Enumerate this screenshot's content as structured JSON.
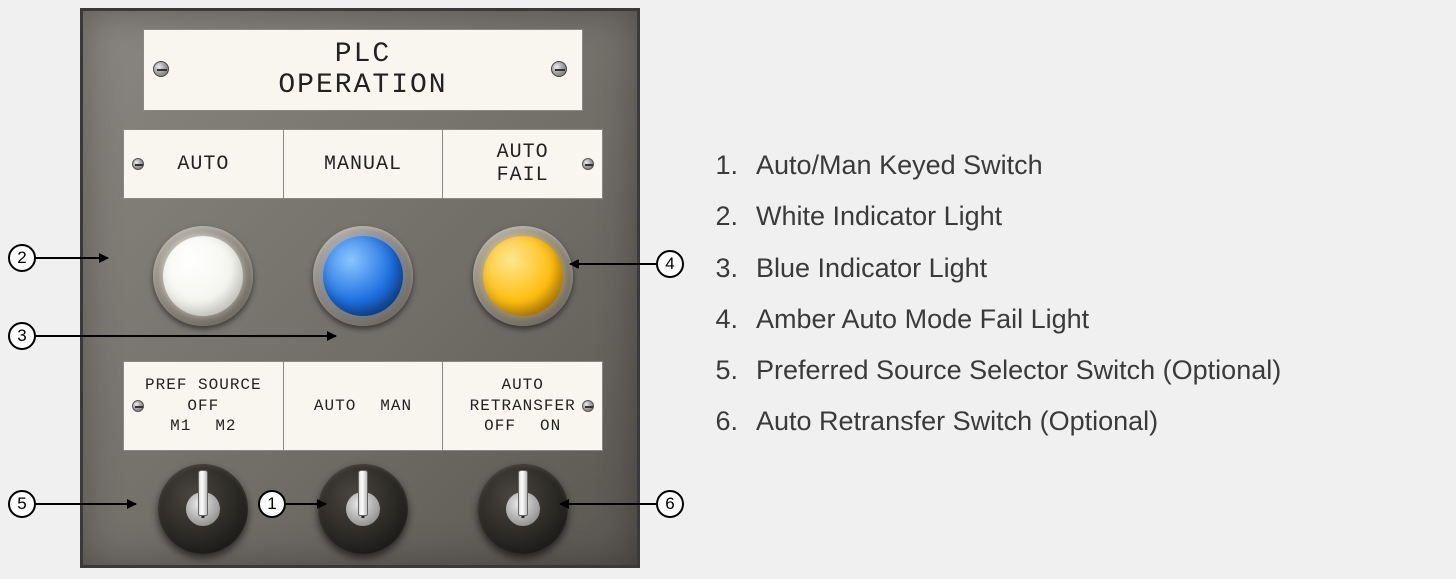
{
  "panel": {
    "title_line1": "PLC",
    "title_line2": "OPERATION",
    "top_labels": {
      "auto": "AUTO",
      "manual": "MANUAL",
      "auto_fail_line1": "AUTO",
      "auto_fail_line2": "FAIL"
    },
    "bottom_labels": {
      "pref_source_line1": "PREF SOURCE",
      "pref_source_line2": "OFF",
      "pref_source_m1": "M1",
      "pref_source_m2": "M2",
      "auto_man_auto": "AUTO",
      "auto_man_man": "MAN",
      "retransfer_line1": "AUTO",
      "retransfer_line2": "RETRANSFER",
      "retransfer_off": "OFF",
      "retransfer_on": "ON"
    }
  },
  "callouts": {
    "n1": "1",
    "n2": "2",
    "n3": "3",
    "n4": "4",
    "n5": "5",
    "n6": "6"
  },
  "legend": [
    {
      "num": "1.",
      "text": "Auto/Man Keyed Switch"
    },
    {
      "num": "2.",
      "text": "White Indicator Light"
    },
    {
      "num": "3.",
      "text": "Blue Indicator Light"
    },
    {
      "num": "4.",
      "text": "Amber Auto Mode Fail Light"
    },
    {
      "num": "5.",
      "text": "Preferred Source Selector Switch (Optional)"
    },
    {
      "num": "6.",
      "text": "Auto Retransfer Switch (Optional)"
    }
  ]
}
